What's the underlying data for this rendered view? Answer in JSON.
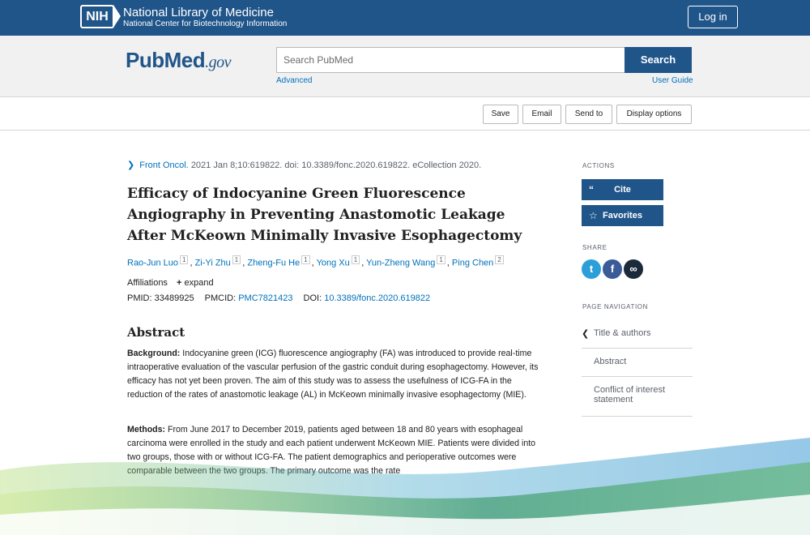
{
  "banner": {
    "logo_text": "NIH",
    "title": "National Library of Medicine",
    "subtitle": "National Center for Biotechnology Information",
    "login_label": "Log in"
  },
  "search": {
    "logo_pub": "Pub",
    "logo_med": "Med",
    "logo_gov": ".gov",
    "placeholder": "Search PubMed",
    "button_label": "Search",
    "advanced_label": "Advanced",
    "guide_label": "User Guide"
  },
  "toolbar": {
    "save": "Save",
    "email": "Email",
    "send_to": "Send to",
    "display_options": "Display options"
  },
  "article": {
    "journal": "Front Oncol.",
    "citation_rest": "2021 Jan 8;10:619822. doi: 10.3389/fonc.2020.619822. eCollection 2020.",
    "title": "Efficacy of Indocyanine Green Fluorescence Angiography in Preventing Anastomotic Leakage After McKeown Minimally Invasive Esophagectomy",
    "authors": [
      {
        "name": "Rao-Jun Luo",
        "aff": "1"
      },
      {
        "name": "Zi-Yi Zhu",
        "aff": "1"
      },
      {
        "name": "Zheng-Fu He",
        "aff": "1"
      },
      {
        "name": "Yong Xu",
        "aff": "1"
      },
      {
        "name": "Yun-Zheng Wang",
        "aff": "1"
      },
      {
        "name": "Ping Chen",
        "aff": "2"
      }
    ],
    "affiliations_label": "Affiliations",
    "expand_label": "expand",
    "pmid_label": "PMID:",
    "pmid": "33489925",
    "pmcid_label": "PMCID:",
    "pmcid": "PMC7821423",
    "doi_label": "DOI:",
    "doi": "10.3389/fonc.2020.619822",
    "abstract_heading": "Abstract",
    "background_label": "Background:",
    "background_text": "Indocyanine green (ICG) fluorescence angiography (FA) was introduced to provide real-time intraoperative evaluation of the vascular perfusion of the gastric conduit during esophagectomy. However, its efficacy has not yet been proven. The aim of this study was to assess the usefulness of ICG-FA in the reduction of the rates of anastomotic leakage (AL) in McKeown minimally invasive esophagectomy (MIE).",
    "methods_label": "Methods:",
    "methods_text": "From June 2017 to December 2019, patients aged between 18 and 80 years with esophageal carcinoma were enrolled in the study and each patient underwent McKeown MIE. Patients were divided into two groups, those with or without ICG-FA. The patient demographics and perioperative outcomes were comparable between the two groups. The primary outcome was the rate"
  },
  "sidebar": {
    "actions_label": "ACTIONS",
    "cite_label": "Cite",
    "favorites_label": "Favorites",
    "share_label": "SHARE",
    "page_nav_label": "PAGE NAVIGATION",
    "nav": [
      "Title & authors",
      "Abstract",
      "Conflict of interest statement"
    ]
  },
  "icons": {
    "cite": "quote-icon",
    "favorites": "star-icon",
    "twitter": "twitter-icon",
    "facebook": "facebook-icon",
    "link": "link-icon"
  },
  "colors": {
    "brand_blue": "#20558a",
    "link_blue": "#0071bc",
    "twitter": "#2c9fd9",
    "facebook": "#3a5a98",
    "permalink": "#1b2a3a"
  }
}
